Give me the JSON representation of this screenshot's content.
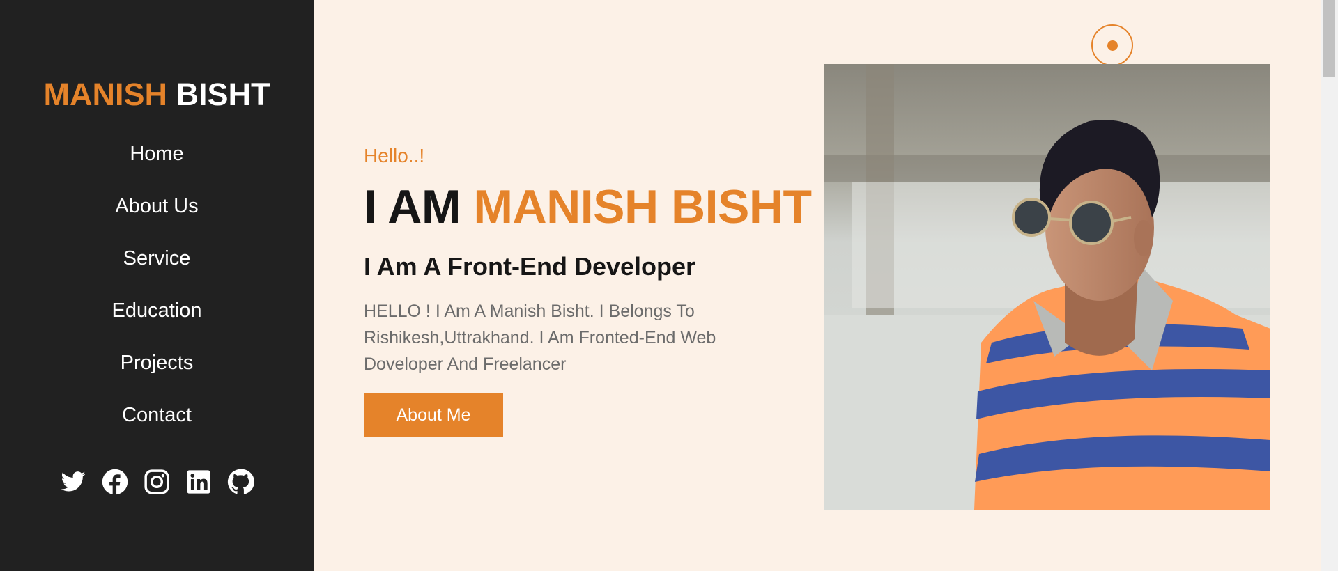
{
  "sidebar": {
    "logo_first": "MANISH",
    "logo_second": "BISHT",
    "nav": [
      "Home",
      "About Us",
      "Service",
      "Education",
      "Projects",
      "Contact"
    ],
    "socials": [
      "twitter-icon",
      "facebook-icon",
      "instagram-icon",
      "linkedin-icon",
      "github-icon"
    ]
  },
  "hero": {
    "greeting": "Hello..!",
    "headline_prefix": "I AM ",
    "headline_name": "MANISH BISHT",
    "subtitle": "I Am A Front-End Developer",
    "bio": "HELLO ! I Am A Manish Bisht. I Belongs To Rishikesh,Uttrakhand. I Am Fronted-End Web Doveloper And Freelancer",
    "cta_label": "About Me"
  },
  "colors": {
    "accent": "#e5832a",
    "sidebar_bg": "#212121",
    "page_bg": "#fcf1e7"
  }
}
